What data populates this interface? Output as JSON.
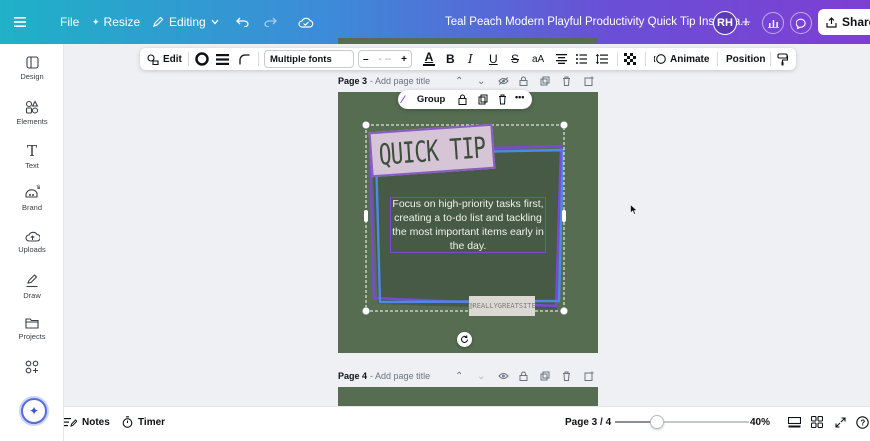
{
  "topbar": {
    "menu_icon": "hamburger-menu-icon",
    "file_label": "File",
    "resize_label": "Resize",
    "editing_label": "Editing",
    "doc_title": "Teal Peach Modern Playful Productivity Quick Tip Instagra...",
    "avatar_initials": "RH",
    "share_label": "Share",
    "colors": {
      "gradient_start": "#1fb1c7",
      "gradient_end": "#7d3fd3"
    }
  },
  "sidebar": {
    "items": [
      {
        "label": "Design",
        "icon": "design-icon"
      },
      {
        "label": "Elements",
        "icon": "elements-icon"
      },
      {
        "label": "Text",
        "icon": "text-icon"
      },
      {
        "label": "Brand",
        "icon": "brand-icon"
      },
      {
        "label": "Uploads",
        "icon": "uploads-icon"
      },
      {
        "label": "Draw",
        "icon": "draw-icon"
      },
      {
        "label": "Projects",
        "icon": "projects-icon"
      },
      {
        "label": "",
        "icon": "apps-icon"
      }
    ]
  },
  "toolbar": {
    "edit_label": "Edit",
    "font_name": "Multiple fonts",
    "size_minus": "–",
    "size_value": "- --",
    "size_plus": "+",
    "animate_label": "Animate",
    "position_label": "Position"
  },
  "pages": {
    "page3_label": "Page 3",
    "page3_title_placeholder": "- Add page title",
    "page4_label": "Page 4",
    "page4_title_placeholder": "- Add page title"
  },
  "group_bar": {
    "label": "Group",
    "more": "•••"
  },
  "design": {
    "headline": "QUICK TIP",
    "body": "Focus on high-priority tasks first, creating a to-do list and tackling the most important items early in the day.",
    "handle": "@REALLYGREATSITE",
    "background": "#566d52",
    "accent": "#7a4ad6"
  },
  "bottombar": {
    "notes_label": "Notes",
    "timer_label": "Timer",
    "page_indicator": "Page 3 / 4",
    "zoom_level": "40%",
    "zoom_slider_fraction": 0.31
  }
}
